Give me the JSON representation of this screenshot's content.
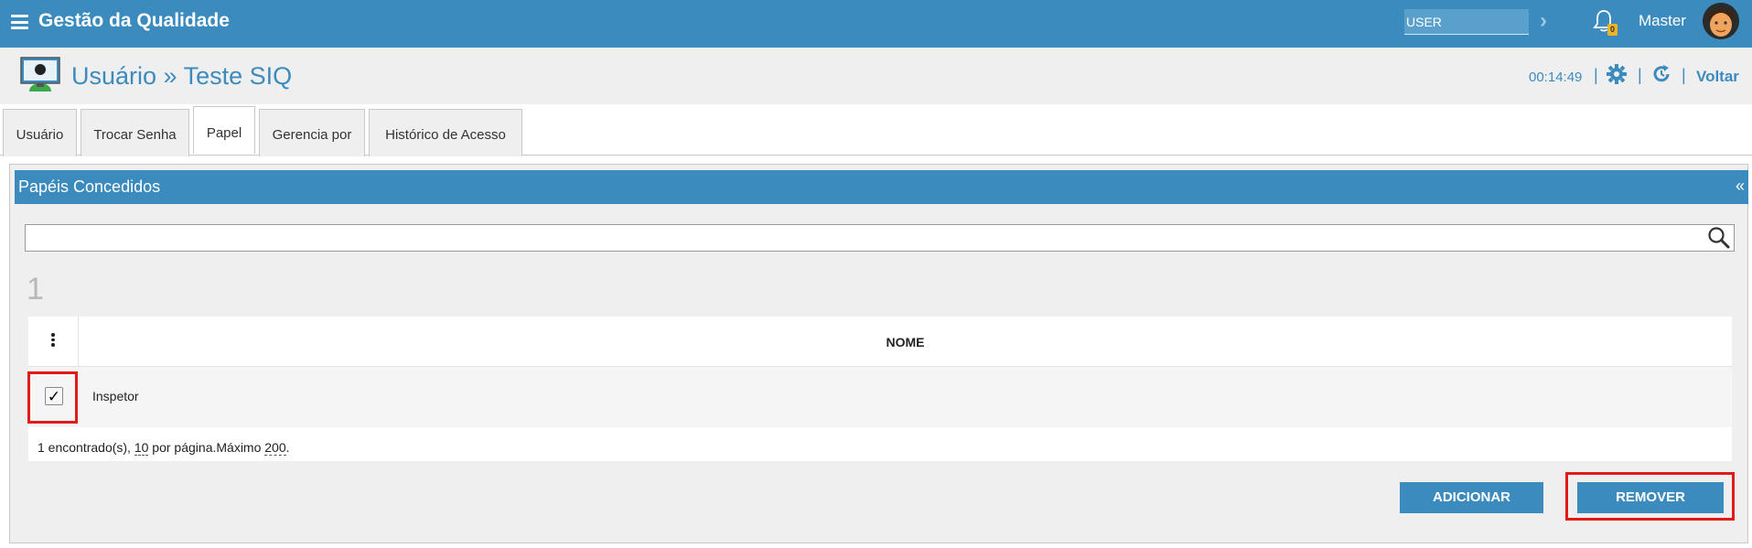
{
  "header": {
    "app_title": "Gestão da Qualidade",
    "user_field_value": "USER",
    "notification_count": "0",
    "username": "Master"
  },
  "page": {
    "breadcrumb": "Usuário » Teste SIQ",
    "clock": "00:14:49",
    "back_label": "Voltar"
  },
  "tabs": [
    {
      "label": "Usuário"
    },
    {
      "label": "Trocar Senha"
    },
    {
      "label": "Papel"
    },
    {
      "label": "Gerencia por"
    },
    {
      "label": "Histórico de Acesso"
    }
  ],
  "panel": {
    "title": "Papéis Concedidos",
    "collapse_symbol": "«",
    "search_value": "",
    "result_count": "1",
    "columns": {
      "nome": "NOME"
    },
    "rows": [
      {
        "checked_symbol": "✓",
        "name": "Inspetor"
      }
    ],
    "footer": {
      "found_text": "1 encontrado(s), ",
      "per_page": "10",
      "per_page_text": " por página.Máximo ",
      "max": "200",
      "end": "."
    },
    "buttons": {
      "add": "ADICIONAR",
      "remove": "REMOVER"
    }
  },
  "colors": {
    "primary": "#3b8bbf",
    "highlight": "#e11a1a"
  }
}
